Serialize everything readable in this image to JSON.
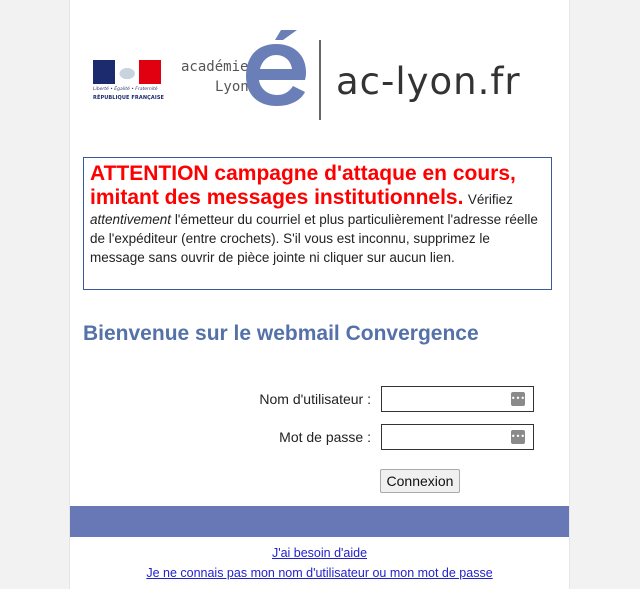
{
  "logos": {
    "republique_motto": "Liberté • Égalité • Fraternité",
    "republique_name": "RÉPUBLIQUE FRANÇAISE",
    "academie_word": "académie",
    "lyon_word": "Lyon",
    "domain": "ac-lyon.fr"
  },
  "alert": {
    "headline": "ATTENTION campagne d'attaque en cours, imitant des messages institutionnels.",
    "body_prefix": "Vérifiez",
    "body_emph": "attentivement",
    "body_rest": "l'émetteur du courriel et plus particulièrement l'adresse réelle de l'expéditeur (entre crochets). S'il vous est inconnu, supprimez le message sans ouvrir de pièce jointe ni cliquer sur aucun lien.",
    "headline_color": "#ff0000"
  },
  "welcome": {
    "title": "Bienvenue sur le webmail Convergence",
    "color": "#5471a9"
  },
  "form": {
    "username_label": "Nom d'utilisateur :",
    "username_value": "",
    "password_label": "Mot de passe :",
    "password_value": "",
    "submit_label": "Connexion",
    "field_icon": "password-manager-icon"
  },
  "footer": {
    "band_color": "#6878b6",
    "help_link": "J'ai besoin d'aide",
    "forgot_link": "Je ne connais pas mon nom d'utilisateur ou mon mot de passe"
  }
}
